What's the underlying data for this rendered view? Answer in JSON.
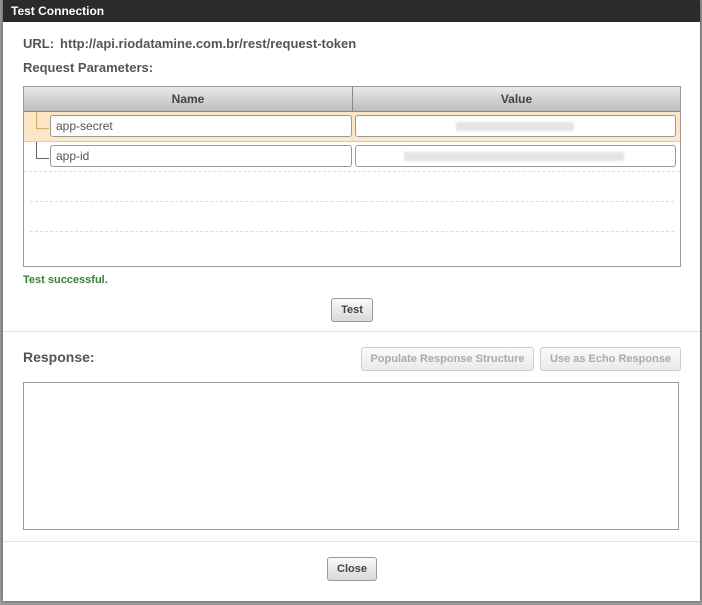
{
  "dialog": {
    "title": "Test Connection",
    "url_label": "URL:",
    "url_value": "http://api.riodatamine.com.br/rest/request-token",
    "request_params_label": "Request Parameters:"
  },
  "grid": {
    "columns": [
      "Name",
      "Value"
    ],
    "rows": [
      {
        "name": "app-secret",
        "selected": true
      },
      {
        "name": "app-id",
        "selected": false
      }
    ]
  },
  "status": {
    "text": "Test successful.",
    "color": "#2e8b2e"
  },
  "buttons": {
    "test": "Test",
    "populate": "Populate Response Structure",
    "echo": "Use as Echo Response",
    "close": "Close"
  },
  "response": {
    "label": "Response:",
    "content": ""
  },
  "colors": {
    "titlebar": "#2b2b2b",
    "selected_row": "#fde6c6"
  }
}
